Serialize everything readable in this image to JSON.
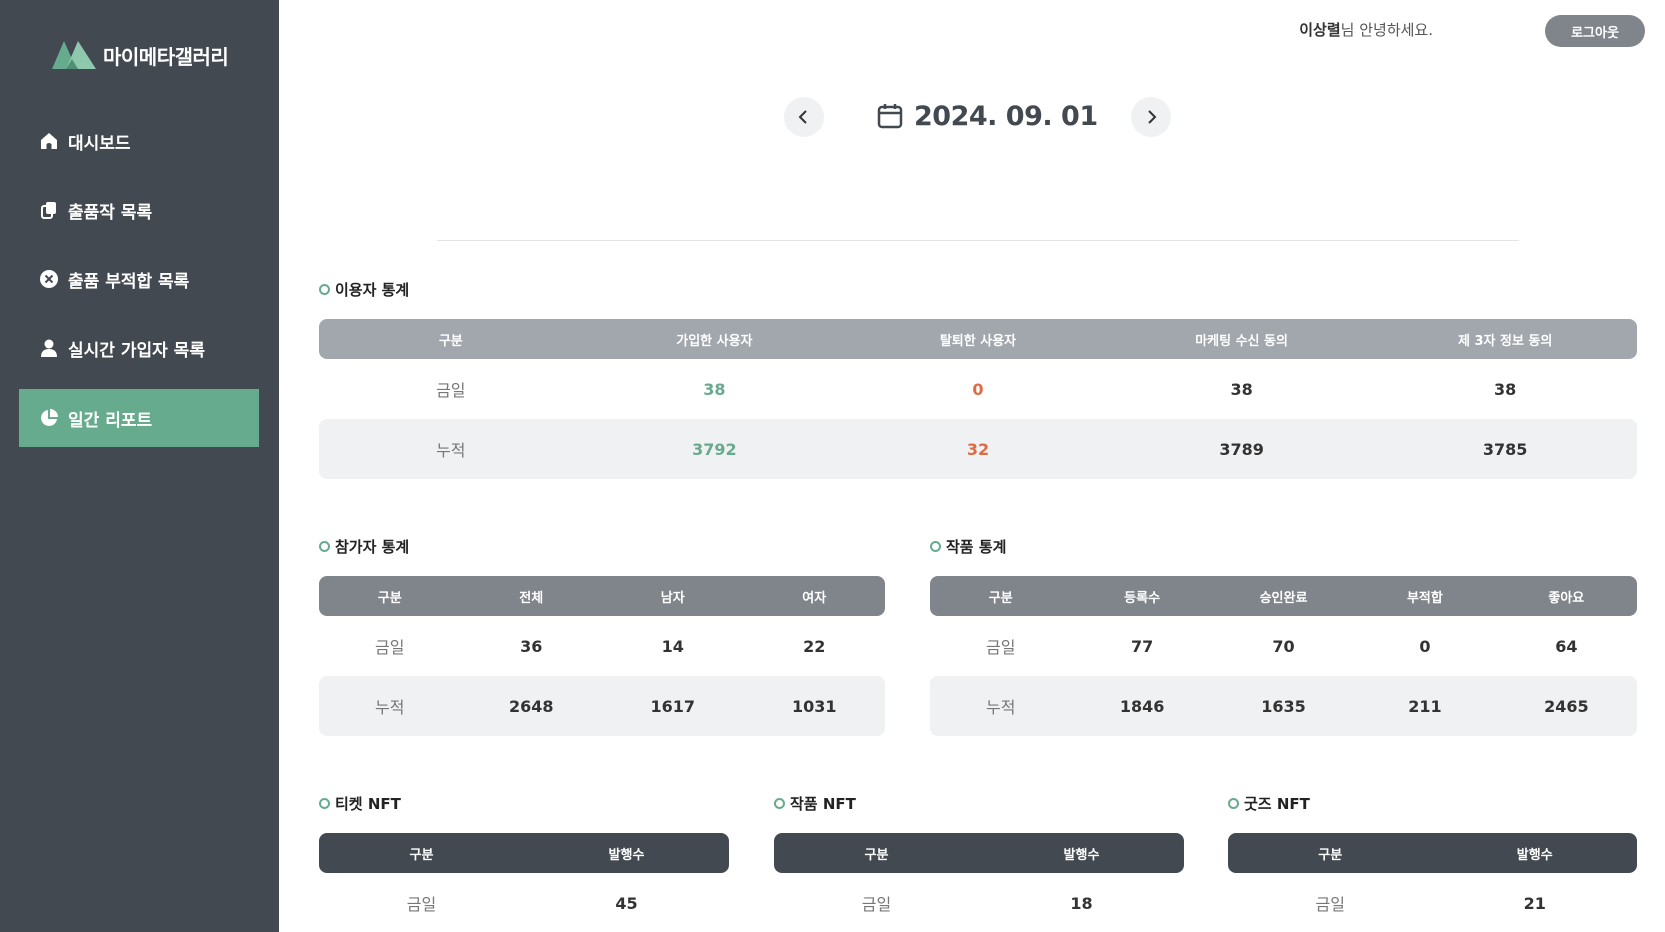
{
  "sidebar": {
    "logo_text": "마이메타갤러리",
    "items": [
      {
        "label": "대시보드",
        "icon": "home-icon"
      },
      {
        "label": "출품작 목록",
        "icon": "copy-icon"
      },
      {
        "label": "출품 부적합 목록",
        "icon": "close-circle-icon"
      },
      {
        "label": "실시간 가입자 목록",
        "icon": "user-icon"
      },
      {
        "label": "일간 리포트",
        "icon": "pie-chart-icon",
        "active": true
      }
    ]
  },
  "header": {
    "user_name": "이상렬",
    "greeting_suffix": "님 안녕하세요.",
    "logout_label": "로그아웃"
  },
  "date_nav": {
    "date": "2024. 09. 01"
  },
  "user_stats": {
    "title": "이용자 통계",
    "headers": [
      "구분",
      "가입한 사용자",
      "탈퇴한 사용자",
      "마케팅 수신 동의",
      "제 3자 정보 동의"
    ],
    "rows": [
      [
        "금일",
        "38",
        "0",
        "38",
        "38"
      ],
      [
        "누적",
        "3792",
        "32",
        "3789",
        "3785"
      ]
    ]
  },
  "participant_stats": {
    "title": "참가자 통계",
    "headers": [
      "구분",
      "전체",
      "남자",
      "여자"
    ],
    "rows": [
      [
        "금일",
        "36",
        "14",
        "22"
      ],
      [
        "누적",
        "2648",
        "1617",
        "1031"
      ]
    ]
  },
  "artwork_stats": {
    "title": "작품 통계",
    "headers": [
      "구분",
      "등록수",
      "승인완료",
      "부적합",
      "좋아요"
    ],
    "rows": [
      [
        "금일",
        "77",
        "70",
        "0",
        "64"
      ],
      [
        "누적",
        "1846",
        "1635",
        "211",
        "2465"
      ]
    ]
  },
  "ticket_nft": {
    "title": "티켓 NFT",
    "headers": [
      "구분",
      "발행수"
    ],
    "rows": [
      [
        "금일",
        "45"
      ]
    ]
  },
  "artwork_nft": {
    "title": "작품 NFT",
    "headers": [
      "구분",
      "발행수"
    ],
    "rows": [
      [
        "금일",
        "18"
      ]
    ]
  },
  "goods_nft": {
    "title": "굿즈 NFT",
    "headers": [
      "구분",
      "발행수"
    ],
    "rows": [
      [
        "금일",
        "21"
      ]
    ]
  },
  "colors": {
    "sidebar_bg": "#434950",
    "accent_green": "#67ab8e",
    "accent_red": "#e06a42"
  }
}
